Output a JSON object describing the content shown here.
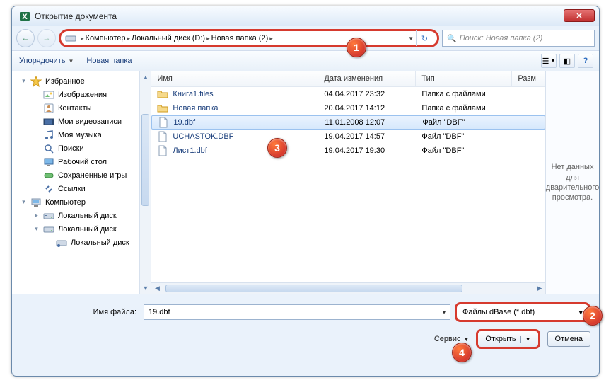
{
  "window": {
    "title": "Открытие документа"
  },
  "breadcrumb": {
    "items": [
      "Компьютер",
      "Локальный диск (D:)",
      "Новая папка (2)"
    ]
  },
  "search": {
    "placeholder": "Поиск: Новая папка (2)"
  },
  "toolbar": {
    "organize": "Упорядочить",
    "newfolder": "Новая папка"
  },
  "tree": {
    "items": [
      {
        "label": "Избранное",
        "icon": "star",
        "lvl": 1,
        "exp": "▾"
      },
      {
        "label": "Изображения",
        "icon": "pictures",
        "lvl": 2
      },
      {
        "label": "Контакты",
        "icon": "contacts",
        "lvl": 2
      },
      {
        "label": "Мои видеозаписи",
        "icon": "video",
        "lvl": 2
      },
      {
        "label": "Моя музыка",
        "icon": "music",
        "lvl": 2
      },
      {
        "label": "Поиски",
        "icon": "search",
        "lvl": 2
      },
      {
        "label": "Рабочий стол",
        "icon": "desktop",
        "lvl": 2
      },
      {
        "label": "Сохраненные игры",
        "icon": "games",
        "lvl": 2
      },
      {
        "label": "Ссылки",
        "icon": "links",
        "lvl": 2
      },
      {
        "label": "Компьютер",
        "icon": "computer",
        "lvl": 1,
        "exp": "▾"
      },
      {
        "label": "Локальный диск",
        "icon": "drive",
        "lvl": 2,
        "exp": "▸"
      },
      {
        "label": "Локальный диск",
        "icon": "drive",
        "lvl": 2,
        "exp": "▾"
      },
      {
        "label": "Локальный диск",
        "icon": "drive-net",
        "lvl": 3
      }
    ]
  },
  "columns": {
    "name": "Имя",
    "date": "Дата изменения",
    "type": "Тип",
    "size": "Разм"
  },
  "files": [
    {
      "name": "Книга1.files",
      "date": "04.04.2017 23:32",
      "type": "Папка с файлами",
      "icon": "folder",
      "selected": false
    },
    {
      "name": "Новая папка",
      "date": "20.04.2017 14:12",
      "type": "Папка с файлами",
      "icon": "folder",
      "selected": false
    },
    {
      "name": "19.dbf",
      "date": "11.01.2008 12:07",
      "type": "Файл \"DBF\"",
      "icon": "file",
      "selected": true
    },
    {
      "name": "UCHASTOK.DBF",
      "date": "19.04.2017 14:57",
      "type": "Файл \"DBF\"",
      "icon": "file",
      "selected": false
    },
    {
      "name": "Лист1.dbf",
      "date": "19.04.2017 19:30",
      "type": "Файл \"DBF\"",
      "icon": "file",
      "selected": false
    }
  ],
  "preview": {
    "text": "Нет данных для дварительного просмотра."
  },
  "footer": {
    "filename_label": "Имя файла:",
    "filename_value": "19.dbf",
    "filetype_value": "Файлы dBase (*.dbf)",
    "service": "Сервис",
    "open": "Открыть",
    "cancel": "Отмена"
  },
  "callouts": {
    "c1": "1",
    "c2": "2",
    "c3": "3",
    "c4": "4"
  }
}
